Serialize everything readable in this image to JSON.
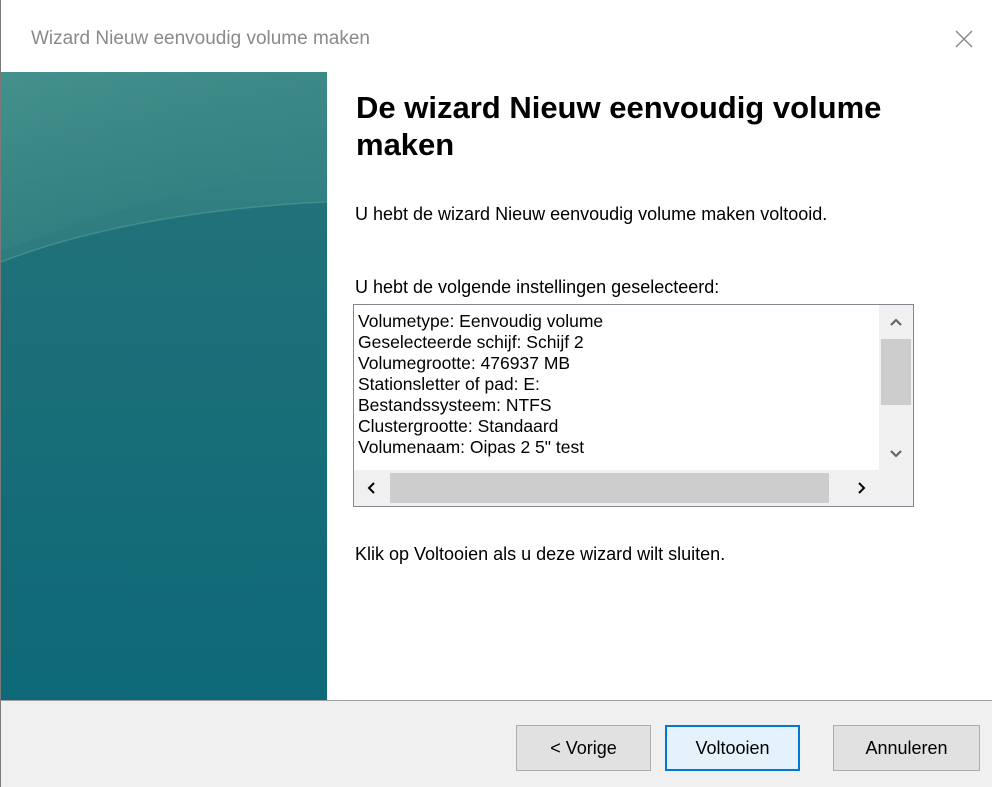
{
  "window": {
    "title": "Wizard Nieuw eenvoudig volume maken",
    "close_icon": "close-icon"
  },
  "colors": {
    "sidebar_top": "#3a8a8a",
    "sidebar_bottom": "#0f6a78",
    "button_default_border": "#0078d7"
  },
  "main": {
    "heading": "De wizard Nieuw eenvoudig volume maken",
    "completed_text": "U hebt de wizard Nieuw eenvoudig volume maken voltooid.",
    "settings_label": "U hebt de volgende instellingen geselecteerd:",
    "settings": [
      "Volumetype: Eenvoudig volume",
      "Geselecteerde schijf: Schijf 2",
      "Volumegrootte: 476937 MB",
      "Stationsletter of pad: E:",
      "Bestandssysteem: NTFS",
      "Clustergrootte: Standaard",
      "Volumenaam: Oipas 2 5\" test"
    ],
    "finish_hint": "Klik op Voltooien als u deze wizard wilt sluiten."
  },
  "footer": {
    "prev_label": "< Vorige",
    "finish_label": "Voltooien",
    "cancel_label": "Annuleren"
  }
}
